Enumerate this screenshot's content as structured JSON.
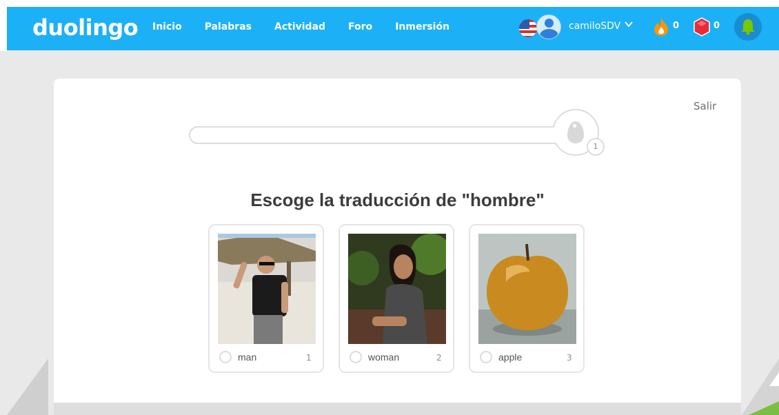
{
  "header": {
    "logo": "duolingo",
    "nav": [
      "Inicio",
      "Palabras",
      "Actividad",
      "Foro",
      "Inmersión"
    ],
    "username": "camiloSDV",
    "streak": "0",
    "gems": "0",
    "colors": {
      "brand": "#1cb0f6",
      "flame": "#ff9600",
      "gem": "#e62c37"
    }
  },
  "lesson": {
    "exit_label": "Salir",
    "progress": 0,
    "egg_count": "1",
    "prompt": "Escoge la traducción de \"hombre\"",
    "choices": [
      {
        "label": "man",
        "key": "1",
        "image": "man-photo"
      },
      {
        "label": "woman",
        "key": "2",
        "image": "woman-photo"
      },
      {
        "label": "apple",
        "key": "3",
        "image": "apple-photo"
      }
    ]
  }
}
